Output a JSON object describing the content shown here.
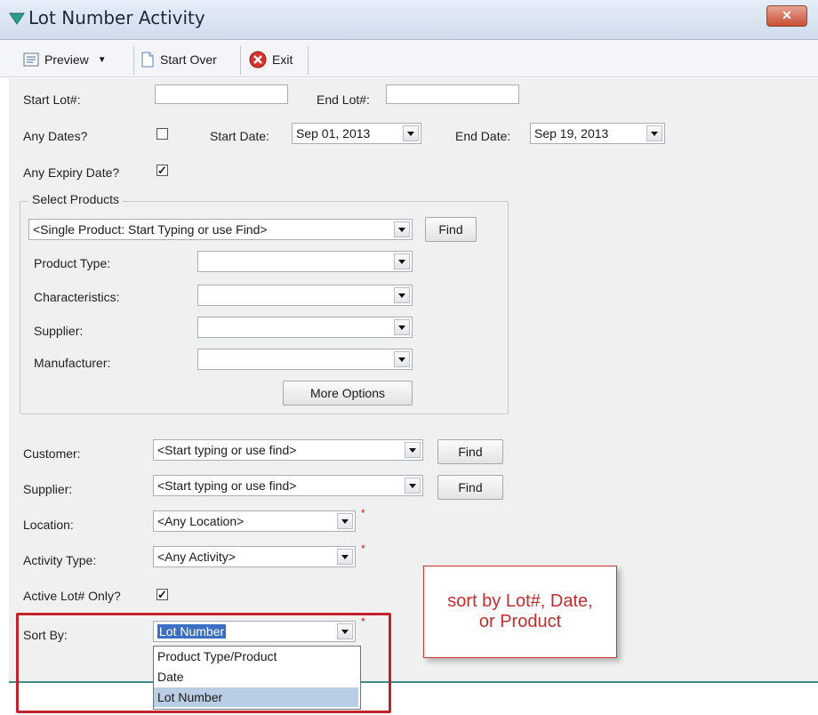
{
  "window": {
    "title": "Lot Number Activity",
    "close_label": "✕"
  },
  "toolbar": {
    "preview_label": "Preview",
    "start_over_label": "Start Over",
    "exit_label": "Exit"
  },
  "form": {
    "start_lot_label": "Start Lot#:",
    "start_lot_value": "",
    "end_lot_label": "End Lot#:",
    "end_lot_value": "",
    "any_dates_label": "Any Dates?",
    "any_dates_checked": false,
    "start_date_label": "Start Date:",
    "start_date_value": "Sep 01, 2013",
    "end_date_label": "End Date:",
    "end_date_value": "Sep 19, 2013",
    "any_expiry_label": "Any Expiry Date?",
    "any_expiry_checked": true
  },
  "select_products": {
    "group_title": "Select Products",
    "product_value": "<Single Product: Start Typing or use Find>",
    "find_label": "Find",
    "product_type_label": "Product Type:",
    "characteristics_label": "Characteristics:",
    "supplier_label": "Supplier:",
    "manufacturer_label": "Manufacturer:",
    "more_options_label": "More Options"
  },
  "filters": {
    "customer_label": "Customer:",
    "customer_value": "<Start typing or use find>",
    "customer_find": "Find",
    "supplier_label": "Supplier:",
    "supplier_value": "<Start typing or use find>",
    "supplier_find": "Find",
    "location_label": "Location:",
    "location_value": "<Any Location>",
    "activity_label": "Activity Type:",
    "activity_value": "<Any Activity>",
    "active_lot_label": "Active Lot# Only?",
    "active_lot_checked": true,
    "sort_by_label": "Sort By:",
    "sort_by_value": "Lot Number",
    "required_mark": "*"
  },
  "sort_options": [
    "Product Type/Product",
    "Date",
    "Lot Number"
  ],
  "annotation": {
    "line1": "sort by Lot#, Date,",
    "line2": "or Product"
  },
  "colors": {
    "annotation": "#c62b2b",
    "highlight": "#c2222a",
    "selected": "#b9cde5"
  }
}
